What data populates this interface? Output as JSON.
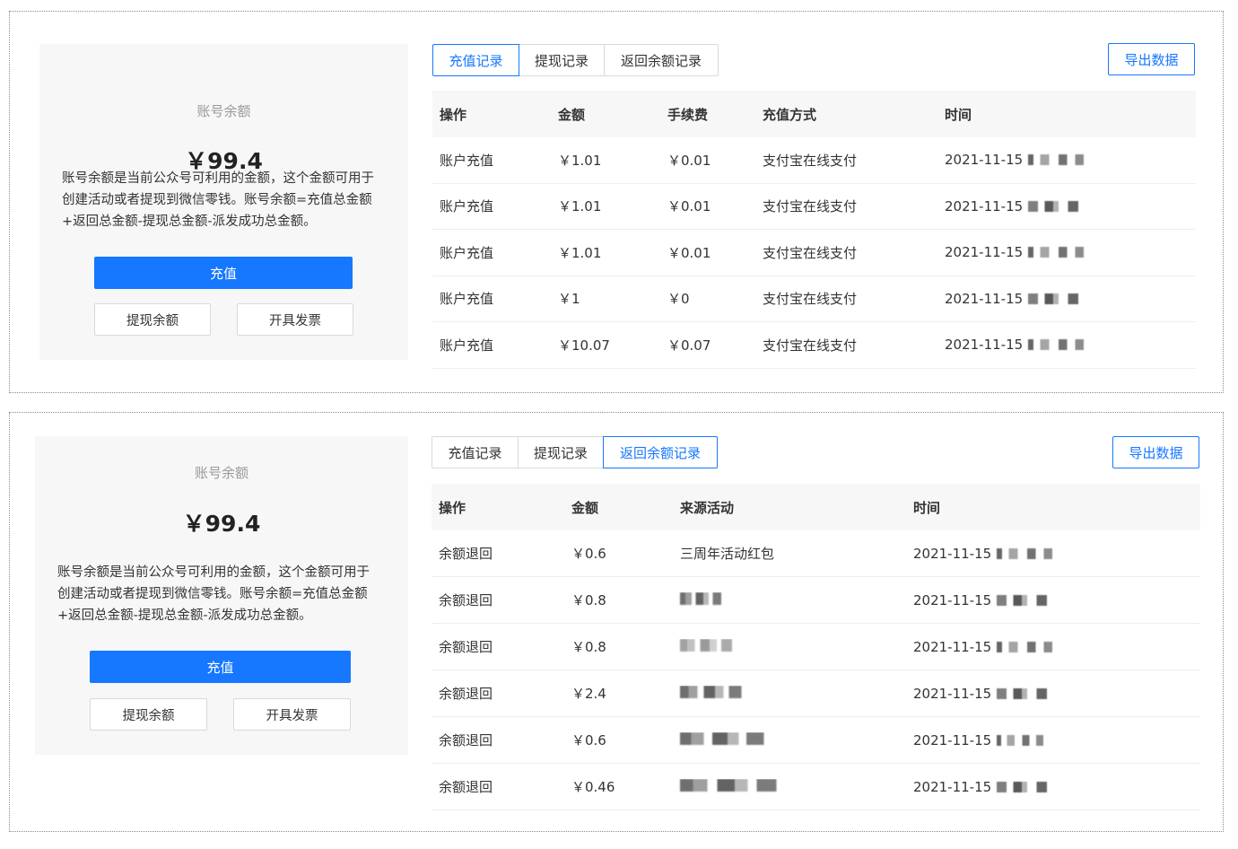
{
  "balance_card": {
    "label": "账号余额",
    "amount": "￥99.4",
    "description": "账号余额是当前公众号可利用的金额，这个金额可用于创建活动或者提现到微信零钱。账号余额=充值总金额+返回总金额-提现总金额-派发成功总金额。",
    "recharge_button": "充值",
    "withdraw_button": "提现余额",
    "invoice_button": "开具发票"
  },
  "tabs": [
    "充值记录",
    "提现记录",
    "返回余额记录"
  ],
  "export_button": "导出数据",
  "recharge_table": {
    "active_tab": "充值记录",
    "columns": [
      "操作",
      "金额",
      "手续费",
      "充值方式",
      "时间"
    ],
    "rows": [
      [
        "账户充值",
        "￥1.01",
        "￥0.01",
        "支付宝在线支付",
        "2021-11-15"
      ],
      [
        "账户充值",
        "￥1.01",
        "￥0.01",
        "支付宝在线支付",
        "2021-11-15"
      ],
      [
        "账户充值",
        "￥1.01",
        "￥0.01",
        "支付宝在线支付",
        "2021-11-15"
      ],
      [
        "账户充值",
        "￥1",
        "￥0",
        "支付宝在线支付",
        "2021-11-15"
      ],
      [
        "账户充值",
        "￥10.07",
        "￥0.07",
        "支付宝在线支付",
        "2021-11-15"
      ]
    ]
  },
  "refund_table": {
    "active_tab": "返回余额记录",
    "columns": [
      "操作",
      "金额",
      "来源活动",
      "时间"
    ],
    "rows": [
      [
        "余额退回",
        "￥0.6",
        "三周年活动红包",
        "2021-11-15"
      ],
      [
        "余额退回",
        "￥0.8",
        "",
        "2021-11-15"
      ],
      [
        "余额退回",
        "￥0.8",
        "",
        "2021-11-15"
      ],
      [
        "余额退回",
        "￥2.4",
        "",
        "2021-11-15"
      ],
      [
        "余额退回",
        "￥0.6",
        "",
        "2021-11-15"
      ],
      [
        "余额退回",
        "￥0.46",
        "",
        "2021-11-15"
      ]
    ]
  },
  "colors": {
    "primary": "#1677ff",
    "card_bg": "#f7f7f7",
    "header_bg": "#f7f7f7"
  }
}
